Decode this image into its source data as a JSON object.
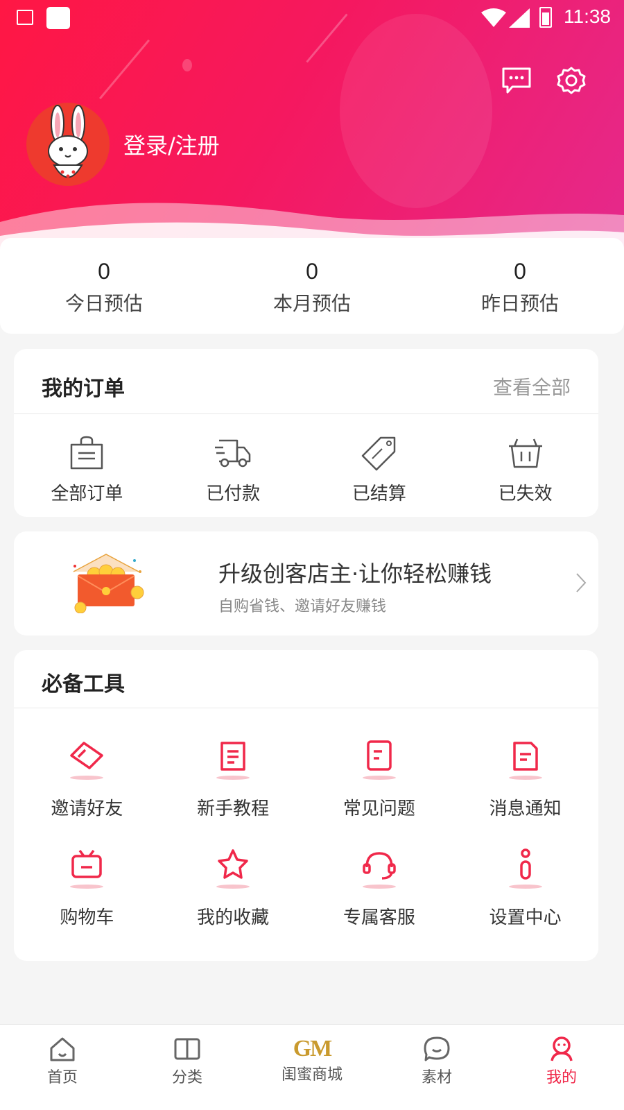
{
  "status_bar": {
    "time": "11:38"
  },
  "header": {
    "login_text": "登录/注册",
    "icons": [
      "message-icon",
      "settings-icon"
    ]
  },
  "stats": [
    {
      "value": "0",
      "label": "今日预估"
    },
    {
      "value": "0",
      "label": "本月预估"
    },
    {
      "value": "0",
      "label": "昨日预估"
    }
  ],
  "orders": {
    "title": "我的订单",
    "view_all": "查看全部",
    "items": [
      {
        "label": "全部订单",
        "icon": "shopping-bag-icon"
      },
      {
        "label": "已付款",
        "icon": "delivery-truck-icon"
      },
      {
        "label": "已结算",
        "icon": "sale-tag-icon"
      },
      {
        "label": "已失效",
        "icon": "basket-icon"
      }
    ]
  },
  "promo": {
    "title": "升级创客店主·让你轻松赚钱",
    "subtitle": "自购省钱、邀请好友赚钱"
  },
  "tools": {
    "title": "必备工具",
    "items": [
      {
        "label": "邀请好友",
        "icon": "invite-card-icon"
      },
      {
        "label": "新手教程",
        "icon": "tutorial-document-icon"
      },
      {
        "label": "常见问题",
        "icon": "faq-document-icon"
      },
      {
        "label": "消息通知",
        "icon": "notification-document-icon"
      },
      {
        "label": "购物车",
        "icon": "cart-tv-icon"
      },
      {
        "label": "我的收藏",
        "icon": "star-icon"
      },
      {
        "label": "专属客服",
        "icon": "headset-icon"
      },
      {
        "label": "设置中心",
        "icon": "info-settings-icon"
      }
    ]
  },
  "tabbar": {
    "items": [
      {
        "label": "首页",
        "icon": "home-icon"
      },
      {
        "label": "分类",
        "icon": "book-icon"
      },
      {
        "label": "闺蜜商城",
        "icon": "gm-logo",
        "logo_text": "GM"
      },
      {
        "label": "素材",
        "icon": "chat-bubble-icon"
      },
      {
        "label": "我的",
        "icon": "profile-icon",
        "active": true
      }
    ]
  },
  "colors": {
    "accent": "#f0284a",
    "header_start": "#ff1744",
    "header_end": "#e5298c",
    "gold": "#c99a2e"
  }
}
